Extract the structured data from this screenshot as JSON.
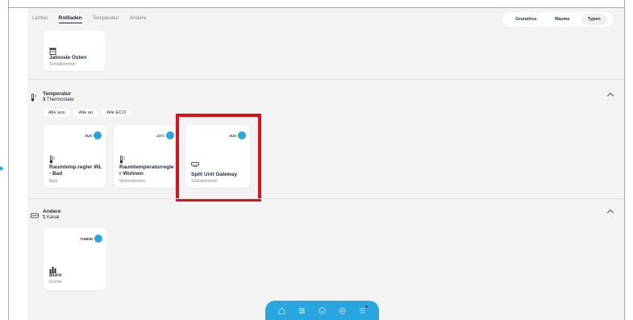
{
  "tabs": [
    {
      "label": "Lichter",
      "active": false
    },
    {
      "label": "Rollladen",
      "active": true
    },
    {
      "label": "Temperatur",
      "active": false
    },
    {
      "label": "Andere",
      "active": false
    }
  ],
  "view_switch": [
    {
      "label": "Grundriss",
      "active": false
    },
    {
      "label": "Räume",
      "active": false
    },
    {
      "label": "Typen",
      "active": true
    }
  ],
  "rollladen_card": {
    "name": "Jalousie Osten",
    "room": "Schlafzimmer",
    "icon": "blind-icon"
  },
  "temperatur": {
    "title": "Temperatur",
    "count": "3",
    "count_label": "Thermostate",
    "icon": "thermometer-icon",
    "chips": [
      "Alle aus",
      "Alle an",
      "Alle ECO"
    ],
    "cards": [
      {
        "name": "Raumtemp.regler WL - Bad",
        "room": "Bad",
        "badge": "AUS",
        "icon": "thermometer-icon"
      },
      {
        "name": "Raumtemperaturregler Wohnen",
        "room": "Wohnzimmer",
        "badge": "21°C",
        "icon": "thermometer-icon"
      },
      {
        "name": "Split Unit Gateway",
        "room": "Schlafzimmer",
        "badge": "AUS",
        "icon": "air-conditioner-icon"
      }
    ]
  },
  "andere": {
    "title": "Andere",
    "count": "1",
    "count_label": "Kanal",
    "icon": "device-icon",
    "cards": [
      {
        "name": "Büro",
        "room": "Küche",
        "badge": "TUNEIN",
        "icon": "equalizer-icon"
      }
    ]
  },
  "bottom_nav": [
    "home-icon",
    "sliders-icon",
    "scenes-icon",
    "settings-icon",
    "menu-icon"
  ],
  "colors": {
    "accent": "#2aa6de",
    "highlight": "#e0101b",
    "background": "#f3f3f3"
  }
}
